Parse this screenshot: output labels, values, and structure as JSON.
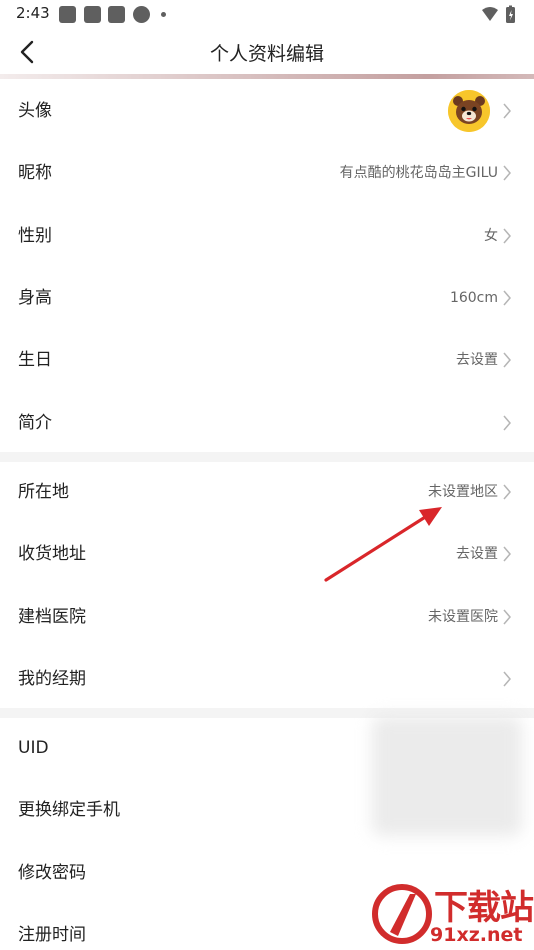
{
  "status_bar": {
    "time": "2:43"
  },
  "header": {
    "title": "个人资料编辑"
  },
  "profile": [
    {
      "label": "头像",
      "value": "",
      "avatar": true
    },
    {
      "label": "昵称",
      "value": "有点酷的桃花岛岛主GILU"
    },
    {
      "label": "性别",
      "value": "女"
    },
    {
      "label": "身高",
      "value": "160cm"
    },
    {
      "label": "生日",
      "value": "去设置"
    },
    {
      "label": "简介",
      "value": ""
    }
  ],
  "location": [
    {
      "label": "所在地",
      "value": "未设置地区"
    },
    {
      "label": "收货地址",
      "value": "去设置"
    },
    {
      "label": "建档医院",
      "value": "未设置医院"
    },
    {
      "label": "我的经期",
      "value": ""
    }
  ],
  "account": [
    {
      "label": "UID",
      "value": ""
    },
    {
      "label": "更换绑定手机",
      "value": ""
    },
    {
      "label": "修改密码",
      "value": ""
    },
    {
      "label": "注册时间",
      "value": ""
    }
  ],
  "watermark": {
    "cn": "下载站",
    "url": "91xz.net"
  },
  "colors": {
    "annotation_arrow": "#d9262a",
    "watermark": "#d12c2c",
    "avatar_bg": "#f7c62b"
  },
  "icons": {
    "back": "chevron-left-icon",
    "row_arrow": "chevron-right-icon",
    "avatar": "bear-avatar"
  }
}
